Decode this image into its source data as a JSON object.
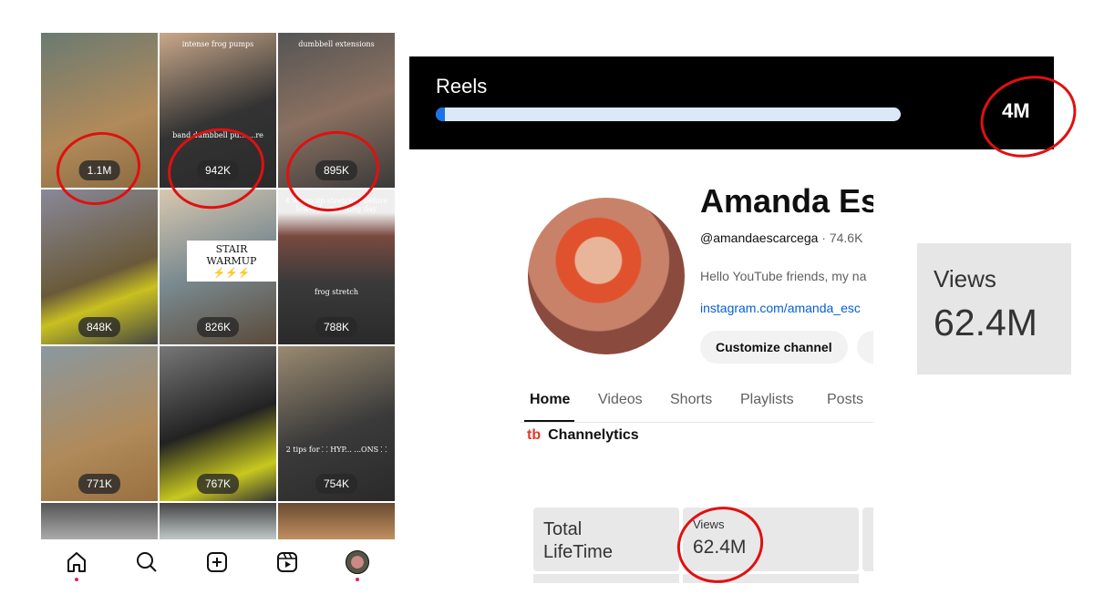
{
  "instagram": {
    "tiles": [
      {
        "count": "1.1M",
        "caption": ""
      },
      {
        "count": "942K",
        "caption": "intense frog pumps",
        "overlay": "band dumbbell pu... ...re"
      },
      {
        "count": "895K",
        "caption": "dumbbell extensions"
      },
      {
        "count": "848K",
        "caption": ""
      },
      {
        "count": "826K",
        "caption": "",
        "sign": "STAIR WARMUP ⚡⚡⚡"
      },
      {
        "count": "788K",
        "caption": "4 warm up stretches before lower body lifting day",
        "overlay": "frog stretch"
      },
      {
        "count": "771K",
        "caption": ""
      },
      {
        "count": "767K",
        "caption": ""
      },
      {
        "count": "754K",
        "caption": "",
        "overlay": "2 tips for ⸬ HYP... ...ONS ⸬"
      },
      {
        "count": ""
      },
      {
        "count": ""
      },
      {
        "count": ""
      }
    ],
    "nav": [
      "home-icon",
      "search-icon",
      "create-icon",
      "reels-icon",
      "profile-avatar"
    ]
  },
  "reels": {
    "label": "Reels",
    "total": "4M",
    "progress_percent": 2,
    "accent": "#1a73e8"
  },
  "youtube": {
    "name": "Amanda Es",
    "handle": "@amandaescarcega",
    "subs": " · 74.6K",
    "description": "Hello YouTube friends, my na",
    "link": "instagram.com/amanda_esc",
    "customize": "Customize channel",
    "tabs": [
      "Home",
      "Videos",
      "Shorts",
      "Playlists",
      "Posts"
    ],
    "channelytics_logo": "tb",
    "channelytics": "Channelytics",
    "stats": {
      "row_label": "Total LifeTime",
      "views_label": "Views",
      "views_value": "62.4M"
    }
  },
  "views_card": {
    "label": "Views",
    "value": "62.4M"
  }
}
